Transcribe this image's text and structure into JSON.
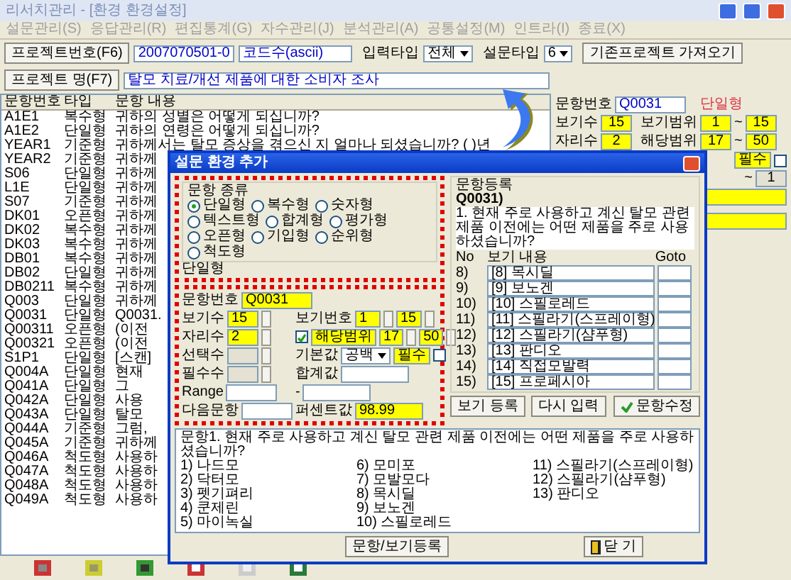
{
  "window": {
    "title": "리서치관리 - [환경 환경설정]"
  },
  "menu": [
    "설문관리(S)",
    "응답관리(R)",
    "편집통계(G)",
    "자수관리(J)",
    "분석관리(A)",
    "공통설정(M)",
    "인트라(I)",
    "종료(X)"
  ],
  "toolbar": {
    "project_no_label": "프로젝트번호(F6)",
    "project_no": "2007070501-0",
    "code_field": "코드수(ascii)",
    "input_type": {
      "label": "입력타입",
      "value": "전체"
    },
    "survey_type": {
      "label": "설문타입",
      "value": "6"
    },
    "import_button": "기존프로젝트 가져오기",
    "project_name_label": "프로젝트 명(F7)",
    "project_name": "탈모 치료/개선 제품에 대한 소비자 조사"
  },
  "question_list": {
    "columns": [
      "문항번호",
      "타입",
      "문항 내용"
    ],
    "rows": [
      {
        "code": "A1E1",
        "type": "복수형",
        "content": "귀하의 성별은 어떻게 되십니까?"
      },
      {
        "code": "A1E2",
        "type": "단일형",
        "content": "귀하의 연령은 어떻게 되십니까?"
      },
      {
        "code": "YEAR1",
        "type": "기준형",
        "content": "귀하께서는 탈모 증상을 겪으신 지 얼마나 되셨습니까? (  )년"
      },
      {
        "code": "YEAR2",
        "type": "기준형",
        "content": "귀하께"
      },
      {
        "code": "S06",
        "type": "단일형",
        "content": "귀하께"
      },
      {
        "code": "L1E",
        "type": "단일형",
        "content": "귀하께"
      },
      {
        "code": "S07",
        "type": "기준형",
        "content": "귀하께"
      },
      {
        "code": "DK01",
        "type": "오픈형",
        "content": "귀하께"
      },
      {
        "code": "DK02",
        "type": "복수형",
        "content": "귀하께"
      },
      {
        "code": "DK03",
        "type": "복수형",
        "content": "귀하께"
      },
      {
        "code": "DB01",
        "type": "복수형",
        "content": "귀하께"
      },
      {
        "code": "DB02",
        "type": "단일형",
        "content": "귀하께"
      },
      {
        "code": "DB0211",
        "type": "복수형",
        "content": "귀하께"
      },
      {
        "code": "Q003",
        "type": "단일형",
        "content": "귀하께"
      },
      {
        "code": "Q0031",
        "type": "단일형",
        "content": "Q0031."
      },
      {
        "code": "Q00311",
        "type": "오픈형",
        "content": "(이전"
      },
      {
        "code": "Q00321",
        "type": "오픈형",
        "content": "(이전"
      },
      {
        "code": "S1P1",
        "type": "단일형",
        "content": "[스캔]"
      },
      {
        "code": "Q004A",
        "type": "단일형",
        "content": "현재"
      },
      {
        "code": "Q041A",
        "type": "단일형",
        "content": "그"
      },
      {
        "code": "Q042A",
        "type": "단일형",
        "content": "사용"
      },
      {
        "code": "Q043A",
        "type": "단일형",
        "content": "탈모"
      },
      {
        "code": "Q044A",
        "type": "기준형",
        "content": "그럼,"
      },
      {
        "code": "Q045A",
        "type": "기준형",
        "content": "귀하께"
      },
      {
        "code": "Q046A",
        "type": "척도형",
        "content": "사용하"
      },
      {
        "code": "Q047A",
        "type": "척도형",
        "content": "사용하"
      },
      {
        "code": "Q048A",
        "type": "척도형",
        "content": "사용하"
      },
      {
        "code": "Q049A",
        "type": "척도형",
        "content": "사용하"
      }
    ]
  },
  "question_panel": {
    "number_label": "문항번호",
    "number": "Q0031",
    "type": "단일형",
    "rows": [
      {
        "label": "보기수",
        "value": "15",
        "range_label": "보기범위",
        "from": "1",
        "sep": "~",
        "to": "15"
      },
      {
        "label": "자리수",
        "value": "2",
        "range_label": "해당범위",
        "from": "17",
        "sep": "~",
        "to": "50"
      }
    ],
    "required": {
      "label": "필수",
      "checked": false
    },
    "range_sep": "~",
    "range_end": "1"
  },
  "dialog": {
    "title": "설문 환경 추가",
    "type_group": {
      "legend": "문항 종류",
      "options": [
        {
          "label": "단일형",
          "selected": true
        },
        {
          "label": "복수형",
          "selected": false
        },
        {
          "label": "숫자형",
          "selected": false
        },
        {
          "label": "텍스트형",
          "selected": false
        },
        {
          "label": "합계형",
          "selected": false
        },
        {
          "label": "평가형",
          "selected": false
        },
        {
          "label": "오픈형",
          "selected": false
        },
        {
          "label": "기입형",
          "selected": false
        },
        {
          "label": "순위형",
          "selected": false
        },
        {
          "label": "척도형",
          "selected": false
        }
      ]
    },
    "current_type": "단일형",
    "number": {
      "label": "문항번호",
      "value": "Q0031"
    },
    "settings": [
      {
        "left": {
          "kind": "spin",
          "label": "보기수",
          "value": "15",
          "highlight": true
        },
        "right": {
          "kind": "pair",
          "label": "보기번호",
          "values": [
            "1",
            "15"
          ],
          "highlight": true
        }
      },
      {
        "left": {
          "kind": "spin",
          "label": "자리수",
          "value": "2",
          "highlight": true
        },
        "right": {
          "kind": "pair",
          "label": "해당범위",
          "checked": true,
          "values": [
            "17",
            "50"
          ],
          "highlight": true
        }
      },
      {
        "left": {
          "kind": "spin",
          "label": "선택수",
          "disabled": true
        },
        "right": {
          "kind": "select",
          "label": "기본값",
          "value": "공백",
          "extra": {
            "label": "필수",
            "checked": false
          }
        }
      },
      {
        "left": {
          "kind": "spin",
          "label": "필수수",
          "disabled": true
        },
        "right": {
          "kind": "text",
          "label": "합계값"
        }
      },
      {
        "left": {
          "kind": "text",
          "label": "Range"
        },
        "right": {
          "kind": "text",
          "label": "-"
        }
      },
      {
        "left": {
          "kind": "text",
          "label": "다음문항"
        },
        "right": {
          "kind": "text",
          "label": "퍼센트값",
          "value": "98.99",
          "highlight": true
        }
      }
    ],
    "entry": {
      "legend": "문항등록",
      "question_id": "Q0031)",
      "question": "1. 현재 주로 사용하고 계신 탈모 관련 제품 이전에는 어떤 제품을 주로 사용하셨습니까?",
      "columns": [
        "No",
        "보기 내용",
        "Goto"
      ],
      "options": [
        {
          "no": "8)",
          "text": "[8] 목시딜"
        },
        {
          "no": "9)",
          "text": "[9] 보노겐"
        },
        {
          "no": "10)",
          "text": "[10] 스필로레드"
        },
        {
          "no": "11)",
          "text": "[11] 스필라기(스프레이형)"
        },
        {
          "no": "12)",
          "text": "[12] 스필라기(샴푸형)"
        },
        {
          "no": "13)",
          "text": "[13] 판디오"
        },
        {
          "no": "14)",
          "text": "[14] 직접모발력"
        },
        {
          "no": "15)",
          "text": "[15] 프로페시아"
        }
      ]
    },
    "buttons": [
      {
        "label": "보기 등록",
        "kind": "plain"
      },
      {
        "label": "다시 입력",
        "kind": "plain"
      },
      {
        "label": "문항수정",
        "kind": "check"
      }
    ],
    "preview": {
      "heading": "문항1. 현재 주로 사용하고 계신 탈모 관련 제품 이전에는 어떤 제품을 주로 사용하셨습니까?",
      "lines": [
        "1) 나드모",
        "2) 닥터모",
        "3) 펫기펴리",
        "4) 쿤제린",
        "5) 마이녹실",
        "6) 모미포",
        "7) 모발모다",
        "8) 목시딜",
        "9) 보노겐",
        "10) 스필로레드",
        "11) 스필라기(스프레이형)",
        "12) 스필라기(샴푸형)",
        "13) 판디오"
      ]
    },
    "footer_buttons": [
      {
        "label": "문항/보기등록",
        "kind": "plain"
      },
      {
        "label": "닫 기",
        "kind": "door"
      }
    ]
  }
}
